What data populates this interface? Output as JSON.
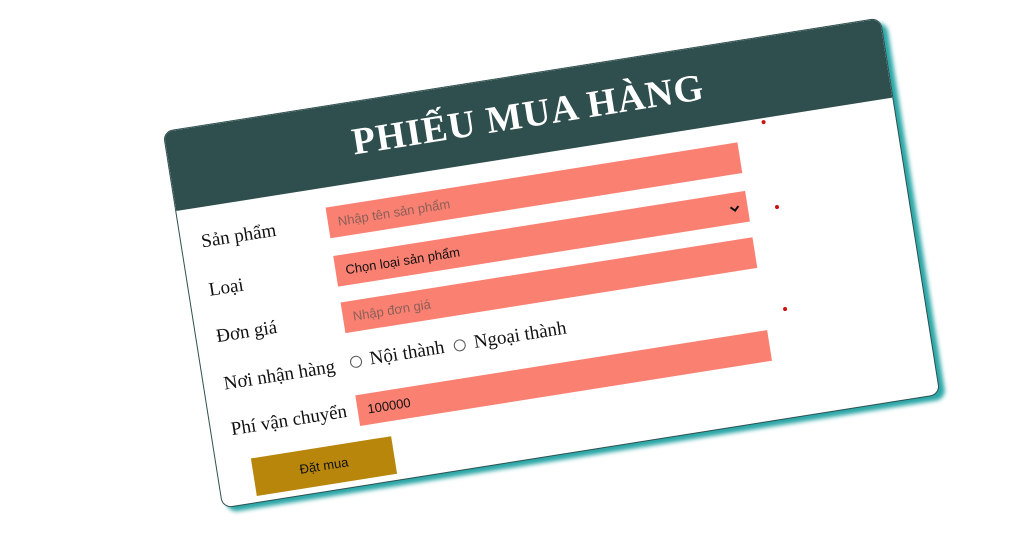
{
  "form": {
    "title": "PHIẾU MUA HÀNG",
    "fields": {
      "san_pham": {
        "label": "Sản phẩm",
        "value": "",
        "placeholder": "Nhập tên sản phẩm"
      },
      "loai": {
        "label": "Loại",
        "selected": "Chọn loại sản phẩm"
      },
      "don_gia": {
        "label": "Đơn giá",
        "value": "",
        "placeholder": "Nhập đơn giá"
      },
      "noi_nhan_hang": {
        "label": "Nơi nhận hàng",
        "options": [
          "Nội thành",
          "Ngoại thành"
        ]
      },
      "phi_van_chuyen": {
        "label": "Phí vận chuyển",
        "value": "100000"
      }
    },
    "submit_label": "Đặt mua"
  },
  "colors": {
    "header_bg": "#2f4f4f",
    "field_bg": "#fa8072",
    "button_bg": "#b8860b",
    "shadow": "#2aa6a6",
    "required_dot": "#d01010"
  },
  "icons": {
    "select_arrow": "chevron-down-icon",
    "required": "required-dot-icon"
  }
}
